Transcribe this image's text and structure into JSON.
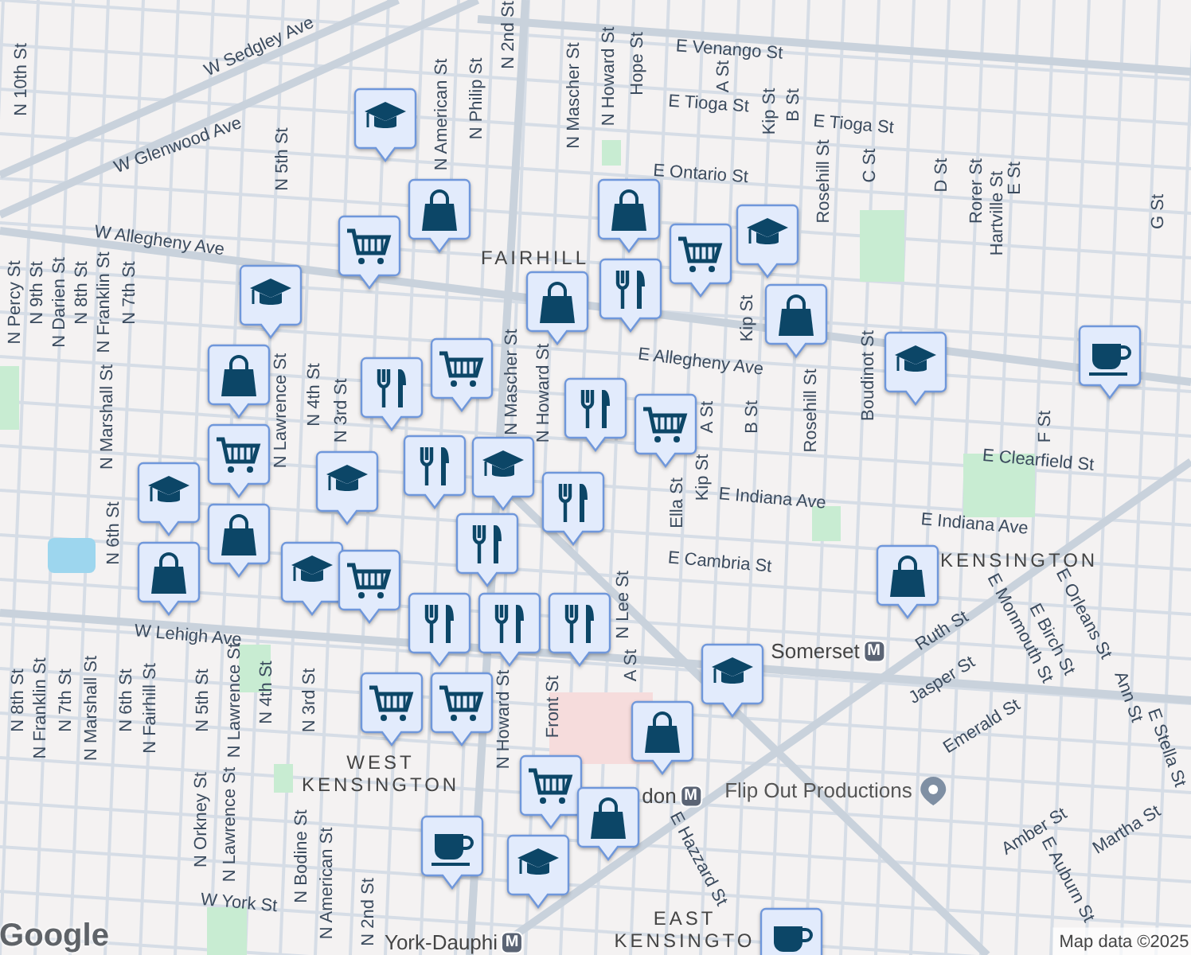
{
  "map": {
    "street_labels": [
      "N 10th St",
      "W Sedgley Ave",
      "W Glenwood Ave",
      "N 5th St",
      "N American St",
      "N Philip St",
      "N 2nd St",
      "N Mascher St",
      "N Howard St",
      "Hope St",
      "A St",
      "Kip St",
      "B St",
      "E Venango St",
      "E Tioga St",
      "E Tioga St",
      "E Ontario St",
      "Rosehill St",
      "C St",
      "D St",
      "Rorer St",
      "Hartville St",
      "E St",
      "G St",
      "W Allegheny Ave",
      "N Percy St",
      "N 9th St",
      "N Darien St",
      "N 8th St",
      "N Franklin St",
      "N 7th St",
      "N Marshall St",
      "N 6th St",
      "N Lawrence St",
      "N 4th St",
      "N 3rd St",
      "N Mascher St",
      "N Howard St",
      "E Allegheny Ave",
      "Kip St",
      "A St",
      "B St",
      "Rosehill St",
      "Boudinot St",
      "F St",
      "E Clearfield St",
      "Ella St",
      "Kip St",
      "E Indiana Ave",
      "E Indiana Ave",
      "E Cambria St",
      "N Lee St",
      "W Lehigh Ave",
      "N 8th St",
      "N Franklin St",
      "N 7th St",
      "N Marshall St",
      "N 6th St",
      "N Fairhill St",
      "N 5th St",
      "N Lawrence St",
      "N 4th St",
      "N 3rd St",
      "N Orkney St",
      "N Lawrence St",
      "W York St",
      "N Bodine St",
      "N American St",
      "N 2nd St",
      "N Howard St",
      "Front St",
      "A St",
      "Ruth St",
      "E Monmouth St",
      "E Orleans St",
      "E Birch St",
      "Jasper St",
      "Emerald St",
      "E Hazzard St",
      "Amber St",
      "E Auburn St",
      "Ann St",
      "E Stella St",
      "Martha St"
    ],
    "area_labels": [
      "FAIRHILL",
      "KENSINGTON",
      "WEST\nKENSINGTON",
      "EAST\nKENSINGTO"
    ],
    "stations": [
      {
        "name": "Somerset",
        "badge": "M"
      },
      {
        "name": "York-Dauphi",
        "badge": "M"
      },
      {
        "name": "don",
        "badge": "M"
      }
    ],
    "places": [
      {
        "name": "Flip Out Productions"
      }
    ],
    "markers": [
      {
        "kind": "school"
      },
      {
        "kind": "shopping"
      },
      {
        "kind": "grocery"
      },
      {
        "kind": "school"
      },
      {
        "kind": "shopping"
      },
      {
        "kind": "restaurant"
      },
      {
        "kind": "grocery"
      },
      {
        "kind": "school"
      },
      {
        "kind": "shopping"
      },
      {
        "kind": "shopping"
      },
      {
        "kind": "grocery"
      },
      {
        "kind": "restaurant"
      },
      {
        "kind": "restaurant"
      },
      {
        "kind": "grocery"
      },
      {
        "kind": "school"
      },
      {
        "kind": "cafe"
      },
      {
        "kind": "shopping"
      },
      {
        "kind": "grocery"
      },
      {
        "kind": "shopping"
      },
      {
        "kind": "school"
      },
      {
        "kind": "school"
      },
      {
        "kind": "restaurant"
      },
      {
        "kind": "shopping"
      },
      {
        "kind": "school"
      },
      {
        "kind": "grocery"
      },
      {
        "kind": "restaurant"
      },
      {
        "kind": "restaurant"
      },
      {
        "kind": "school"
      },
      {
        "kind": "restaurant"
      },
      {
        "kind": "restaurant"
      },
      {
        "kind": "grocery"
      },
      {
        "kind": "restaurant"
      },
      {
        "kind": "grocery"
      },
      {
        "kind": "school"
      },
      {
        "kind": "shopping"
      },
      {
        "kind": "shopping"
      },
      {
        "kind": "grocery"
      },
      {
        "kind": "school"
      },
      {
        "kind": "shopping"
      },
      {
        "kind": "cafe"
      },
      {
        "kind": "cafe"
      }
    ],
    "logo": "Google",
    "attribution": "Map data ©2025"
  }
}
